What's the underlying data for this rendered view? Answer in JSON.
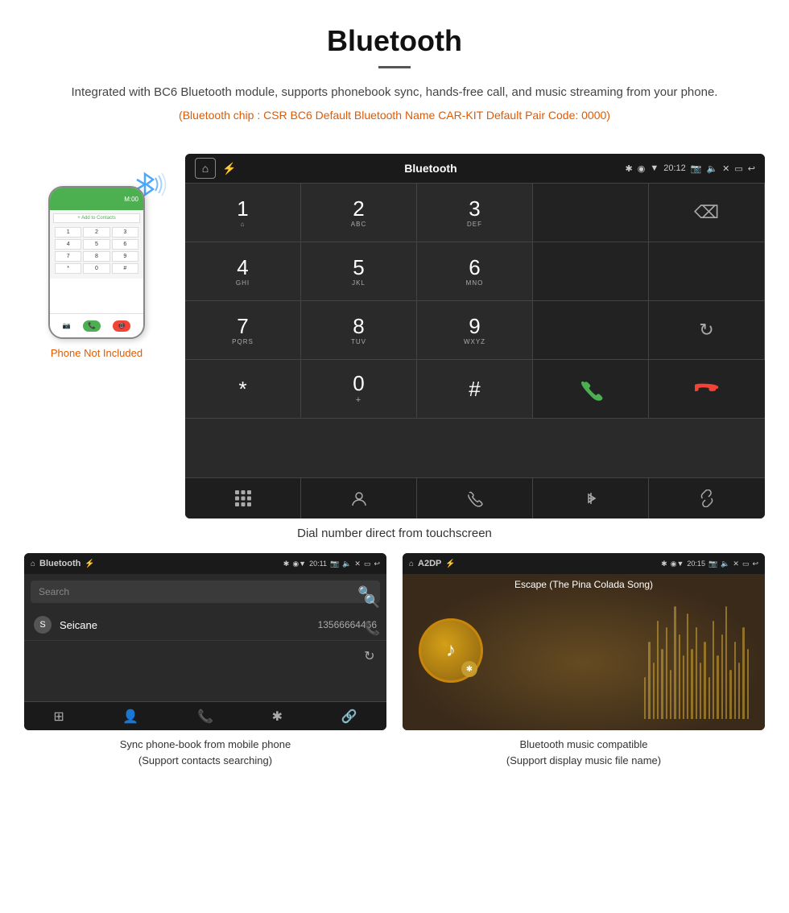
{
  "header": {
    "title": "Bluetooth",
    "description": "Integrated with BC6 Bluetooth module, supports phonebook sync, hands-free call, and music streaming from your phone.",
    "specs": "(Bluetooth chip : CSR BC6    Default Bluetooth Name CAR-KIT    Default Pair Code: 0000)"
  },
  "dial_screen": {
    "statusbar": {
      "app_name": "Bluetooth",
      "time": "20:12"
    },
    "keys": [
      {
        "num": "1",
        "sub": "⌂",
        "type": "digit"
      },
      {
        "num": "2",
        "sub": "ABC",
        "type": "digit"
      },
      {
        "num": "3",
        "sub": "DEF",
        "type": "digit"
      },
      {
        "num": "",
        "sub": "",
        "type": "empty"
      },
      {
        "num": "⌫",
        "sub": "",
        "type": "backspace"
      },
      {
        "num": "4",
        "sub": "GHI",
        "type": "digit"
      },
      {
        "num": "5",
        "sub": "JKL",
        "type": "digit"
      },
      {
        "num": "6",
        "sub": "MNO",
        "type": "digit"
      },
      {
        "num": "",
        "sub": "",
        "type": "empty"
      },
      {
        "num": "",
        "sub": "",
        "type": "empty"
      },
      {
        "num": "7",
        "sub": "PQRS",
        "type": "digit"
      },
      {
        "num": "8",
        "sub": "TUV",
        "type": "digit"
      },
      {
        "num": "9",
        "sub": "WXYZ",
        "type": "digit"
      },
      {
        "num": "",
        "sub": "",
        "type": "empty"
      },
      {
        "num": "↻",
        "sub": "",
        "type": "refresh"
      },
      {
        "num": "*",
        "sub": "",
        "type": "digit"
      },
      {
        "num": "0",
        "sub": "+",
        "type": "digit"
      },
      {
        "num": "#",
        "sub": "",
        "type": "digit"
      },
      {
        "num": "📞",
        "sub": "",
        "type": "call-green"
      },
      {
        "num": "📵",
        "sub": "",
        "type": "call-red"
      }
    ],
    "action_icons": [
      "⊞",
      "👤",
      "📞",
      "✱",
      "🔗"
    ],
    "caption": "Dial number direct from touchscreen"
  },
  "phone_note": "Phone Not Included",
  "phonebook_screen": {
    "statusbar_title": "Bluetooth",
    "time": "20:11",
    "search_placeholder": "Search",
    "contact_letter": "S",
    "contact_name": "Seicane",
    "contact_number": "13566664466",
    "caption_line1": "Sync phone-book from mobile phone",
    "caption_line2": "(Support contacts searching)"
  },
  "music_screen": {
    "statusbar_title": "A2DP",
    "time": "20:15",
    "song_title": "Escape (The Pina Colada Song)",
    "eq_heights": [
      30,
      55,
      40,
      70,
      50,
      65,
      35,
      80,
      60,
      45,
      75,
      50,
      65,
      40,
      55,
      30,
      70,
      45,
      60,
      80,
      35,
      55,
      40,
      65,
      50
    ],
    "caption_line1": "Bluetooth music compatible",
    "caption_line2": "(Support display music file name)"
  }
}
